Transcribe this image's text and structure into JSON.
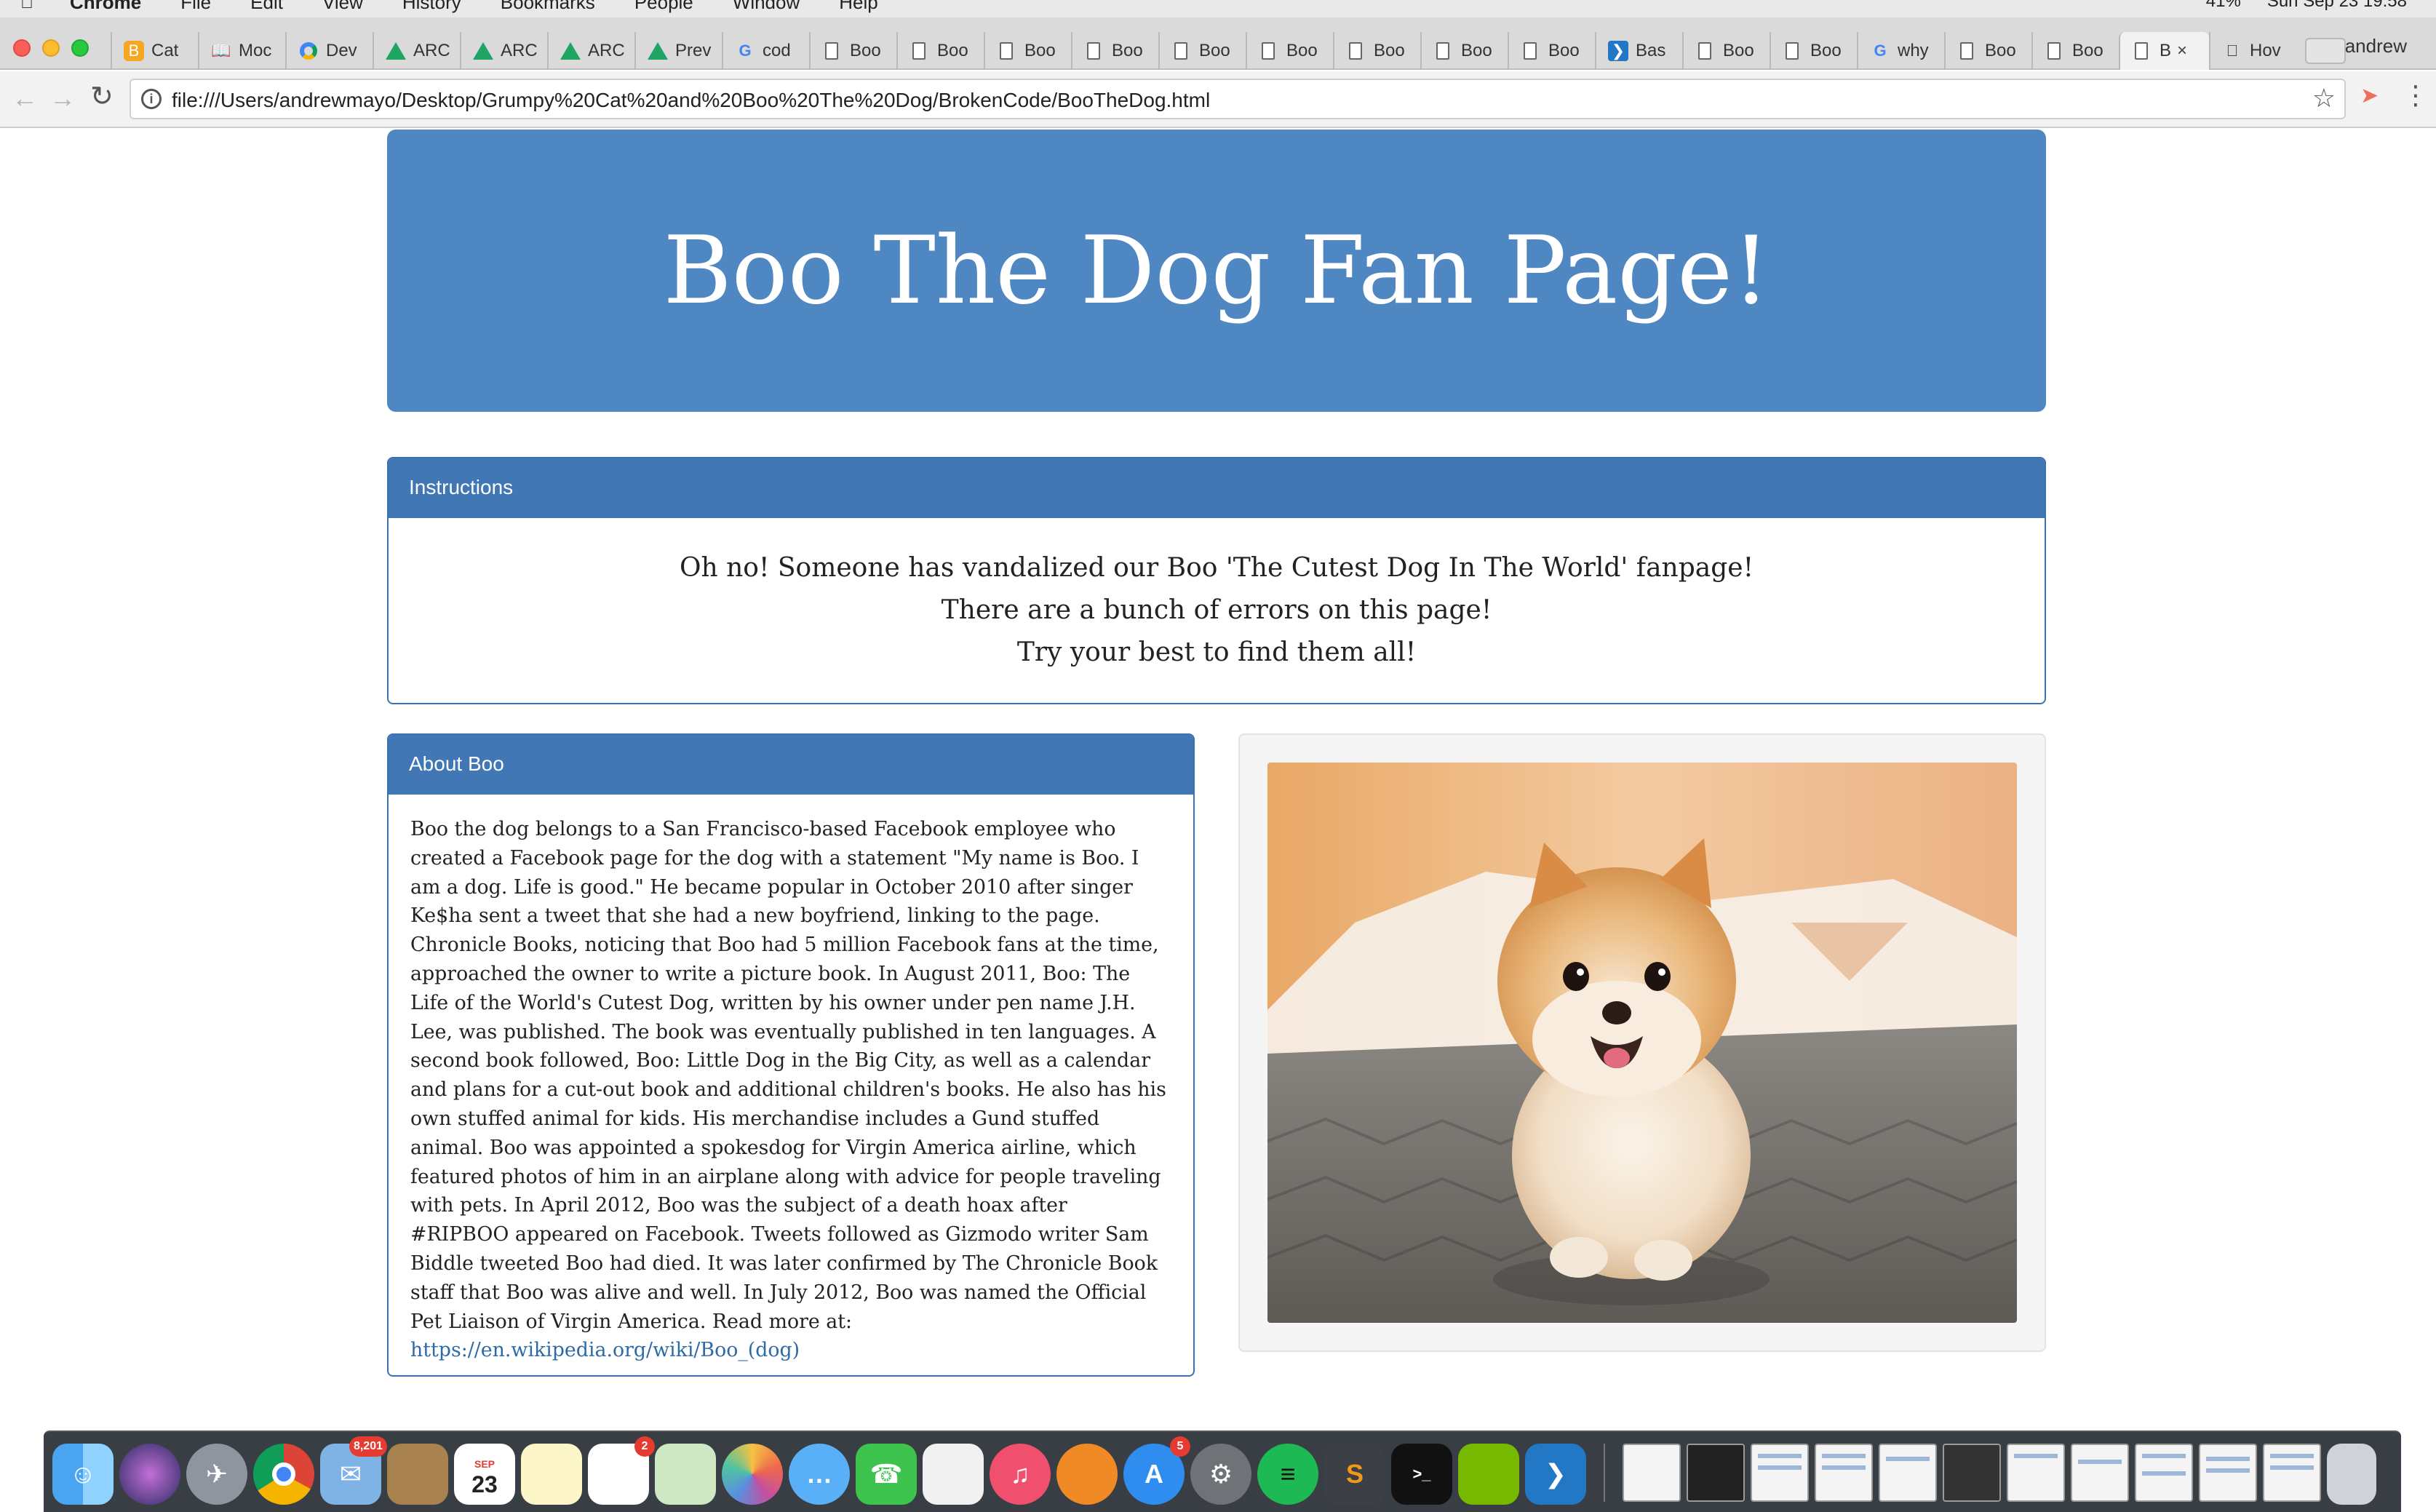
{
  "menubar": {
    "items": [
      "Chrome",
      "File",
      "Edit",
      "View",
      "History",
      "Bookmarks",
      "People",
      "Window",
      "Help"
    ],
    "battery": "41%",
    "clock": "Sun Sep 23  19:58"
  },
  "browser": {
    "tabs": [
      {
        "label": "Cat",
        "icon": "orange-bookmark-icon"
      },
      {
        "label": "Moc",
        "icon": "book-icon"
      },
      {
        "label": "Dev",
        "icon": "chrome-dev-icon"
      },
      {
        "label": "ARC",
        "icon": "google-drive-icon"
      },
      {
        "label": "ARC",
        "icon": "google-drive-icon"
      },
      {
        "label": "ARC",
        "icon": "google-drive-icon"
      },
      {
        "label": "Prev",
        "icon": "google-drive-icon"
      },
      {
        "label": "cod",
        "icon": "google-icon"
      },
      {
        "label": "Boo",
        "icon": "document-icon"
      },
      {
        "label": "Boo",
        "icon": "document-icon"
      },
      {
        "label": "Boo",
        "icon": "document-icon"
      },
      {
        "label": "Boo",
        "icon": "document-icon"
      },
      {
        "label": "Boo",
        "icon": "document-icon"
      },
      {
        "label": "Boo",
        "icon": "document-icon"
      },
      {
        "label": "Boo",
        "icon": "document-icon"
      },
      {
        "label": "Boo",
        "icon": "document-icon"
      },
      {
        "label": "Boo",
        "icon": "document-icon"
      },
      {
        "label": "Bas",
        "icon": "vscode-icon"
      },
      {
        "label": "Boo",
        "icon": "document-icon"
      },
      {
        "label": "Boo",
        "icon": "document-icon"
      },
      {
        "label": "why",
        "icon": "google-icon"
      },
      {
        "label": "Boo",
        "icon": "document-icon"
      },
      {
        "label": "Boo",
        "icon": "document-icon"
      }
    ],
    "active_tab": {
      "label": "B",
      "icon": "document-icon"
    },
    "last_tab": {
      "label": "Hov",
      "icon": "apple-icon"
    },
    "profile_name": "andrew",
    "url": "file:///Users/andrewmayo/Desktop/Grumpy%20Cat%20and%20Boo%20The%20Dog/BrokenCode/BooTheDog.html"
  },
  "page": {
    "title": "Boo The Dog Fan Page!",
    "instructions": {
      "heading": "Instructions",
      "lines": [
        "Oh no! Someone has vandalized our Boo 'The Cutest Dog In The World' fanpage!",
        "There are a bunch of errors on this page!",
        "Try your best to find them all!"
      ]
    },
    "about": {
      "heading": "About Boo",
      "text": "Boo the dog belongs to a San Francisco-based Facebook employee who created a Facebook page for the dog with a statement \"My name is Boo. I am a dog. Life is good.\" He became popular in October 2010 after singer Ke$ha sent a tweet that she had a new boyfriend, linking to the page. Chronicle Books, noticing that Boo had 5 million Facebook fans at the time, approached the owner to write a picture book. In August 2011, Boo: The Life of the World's Cutest Dog, written by his owner under pen name J.H. Lee, was published. The book was eventually published in ten languages. A second book followed, Boo: Little Dog in the Big City, as well as a calendar and plans for a cut-out book and additional children's books. He also has his own stuffed animal for kids. His merchandise includes a Gund stuffed animal. Boo was appointed a spokesdog for Virgin America airline, which featured photos of him in an airplane along with advice for people traveling with pets. In April 2012, Boo was the subject of a death hoax after #RIPBOO appeared on Facebook. Tweets followed as Gizmodo writer Sam Biddle tweeted Boo had died. It was later confirmed by The Chronicle Book staff that Boo was alive and well. In July 2012, Boo was named the Official Pet Liaison of Virgin America. Read more at: ",
      "link": "https://en.wikipedia.org/wiki/Boo_(dog)"
    },
    "photo": {
      "subject": "pomeranian-dog-photo"
    }
  },
  "dock": {
    "badges": {
      "mail": "8,201",
      "calendar_month": "SEP",
      "calendar_day": "23",
      "reminders": "2",
      "appstore": "5"
    }
  },
  "colors": {
    "jumbotron": "#4f87c2",
    "panel_heading": "#4077b4",
    "link": "#2e6aa5"
  }
}
